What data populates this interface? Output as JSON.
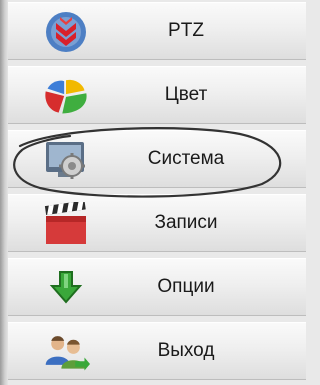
{
  "menu": {
    "items": [
      {
        "label": "PTZ",
        "icon": "ptz-icon"
      },
      {
        "label": "Цвет",
        "icon": "color-icon"
      },
      {
        "label": "Система",
        "icon": "system-icon"
      },
      {
        "label": "Записи",
        "icon": "records-icon"
      },
      {
        "label": "Опции",
        "icon": "options-icon"
      },
      {
        "label": "Выход",
        "icon": "exit-icon"
      }
    ]
  },
  "colors": {
    "ptz_red": "#d9202a",
    "options_green": "#3aa83a",
    "records_red": "#d63a3a",
    "scribble": "#333333"
  }
}
